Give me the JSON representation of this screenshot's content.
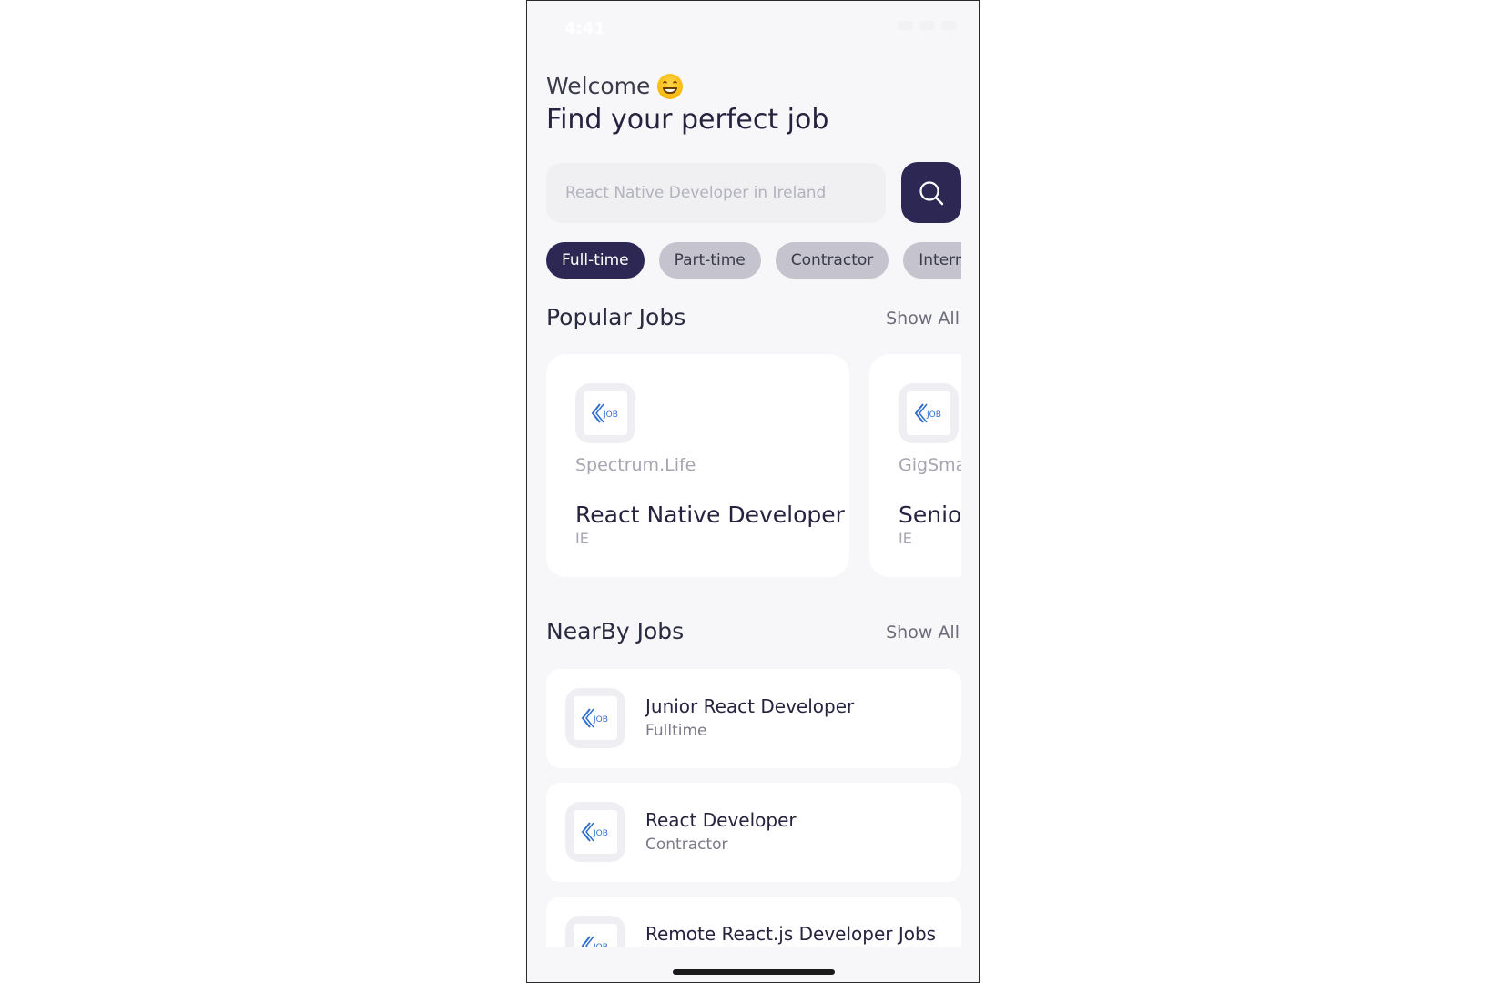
{
  "status_bar": {
    "time": "4:41"
  },
  "header": {
    "welcome": "Welcome",
    "emoji": "grinning-face",
    "headline": "Find your perfect job"
  },
  "search": {
    "placeholder": "React Native Developer in Ireland",
    "button_icon": "search-icon"
  },
  "job_types": [
    {
      "label": "Full-time",
      "active": true
    },
    {
      "label": "Part-time",
      "active": false
    },
    {
      "label": "Contractor",
      "active": false
    },
    {
      "label": "Intern",
      "active": false
    }
  ],
  "popular": {
    "title": "Popular Jobs",
    "show_all": "Show All",
    "jobs": [
      {
        "company": "Spectrum.Life",
        "title": "React Native Developer",
        "location": "IE"
      },
      {
        "company": "GigSma",
        "title": "Senior",
        "location": "IE"
      }
    ]
  },
  "nearby": {
    "title": "NearBy Jobs",
    "show_all": "Show All",
    "jobs": [
      {
        "title": "Junior React Developer",
        "type": "Fulltime"
      },
      {
        "title": "React Developer",
        "type": "Contractor"
      },
      {
        "title": "Remote React.js Developer Jobs",
        "type": ""
      }
    ]
  },
  "colors": {
    "primary": "#2d2754",
    "chip_inactive": "#c4c3ce",
    "background": "#f7f7fa",
    "logo_blue": "#2f6fd0"
  }
}
